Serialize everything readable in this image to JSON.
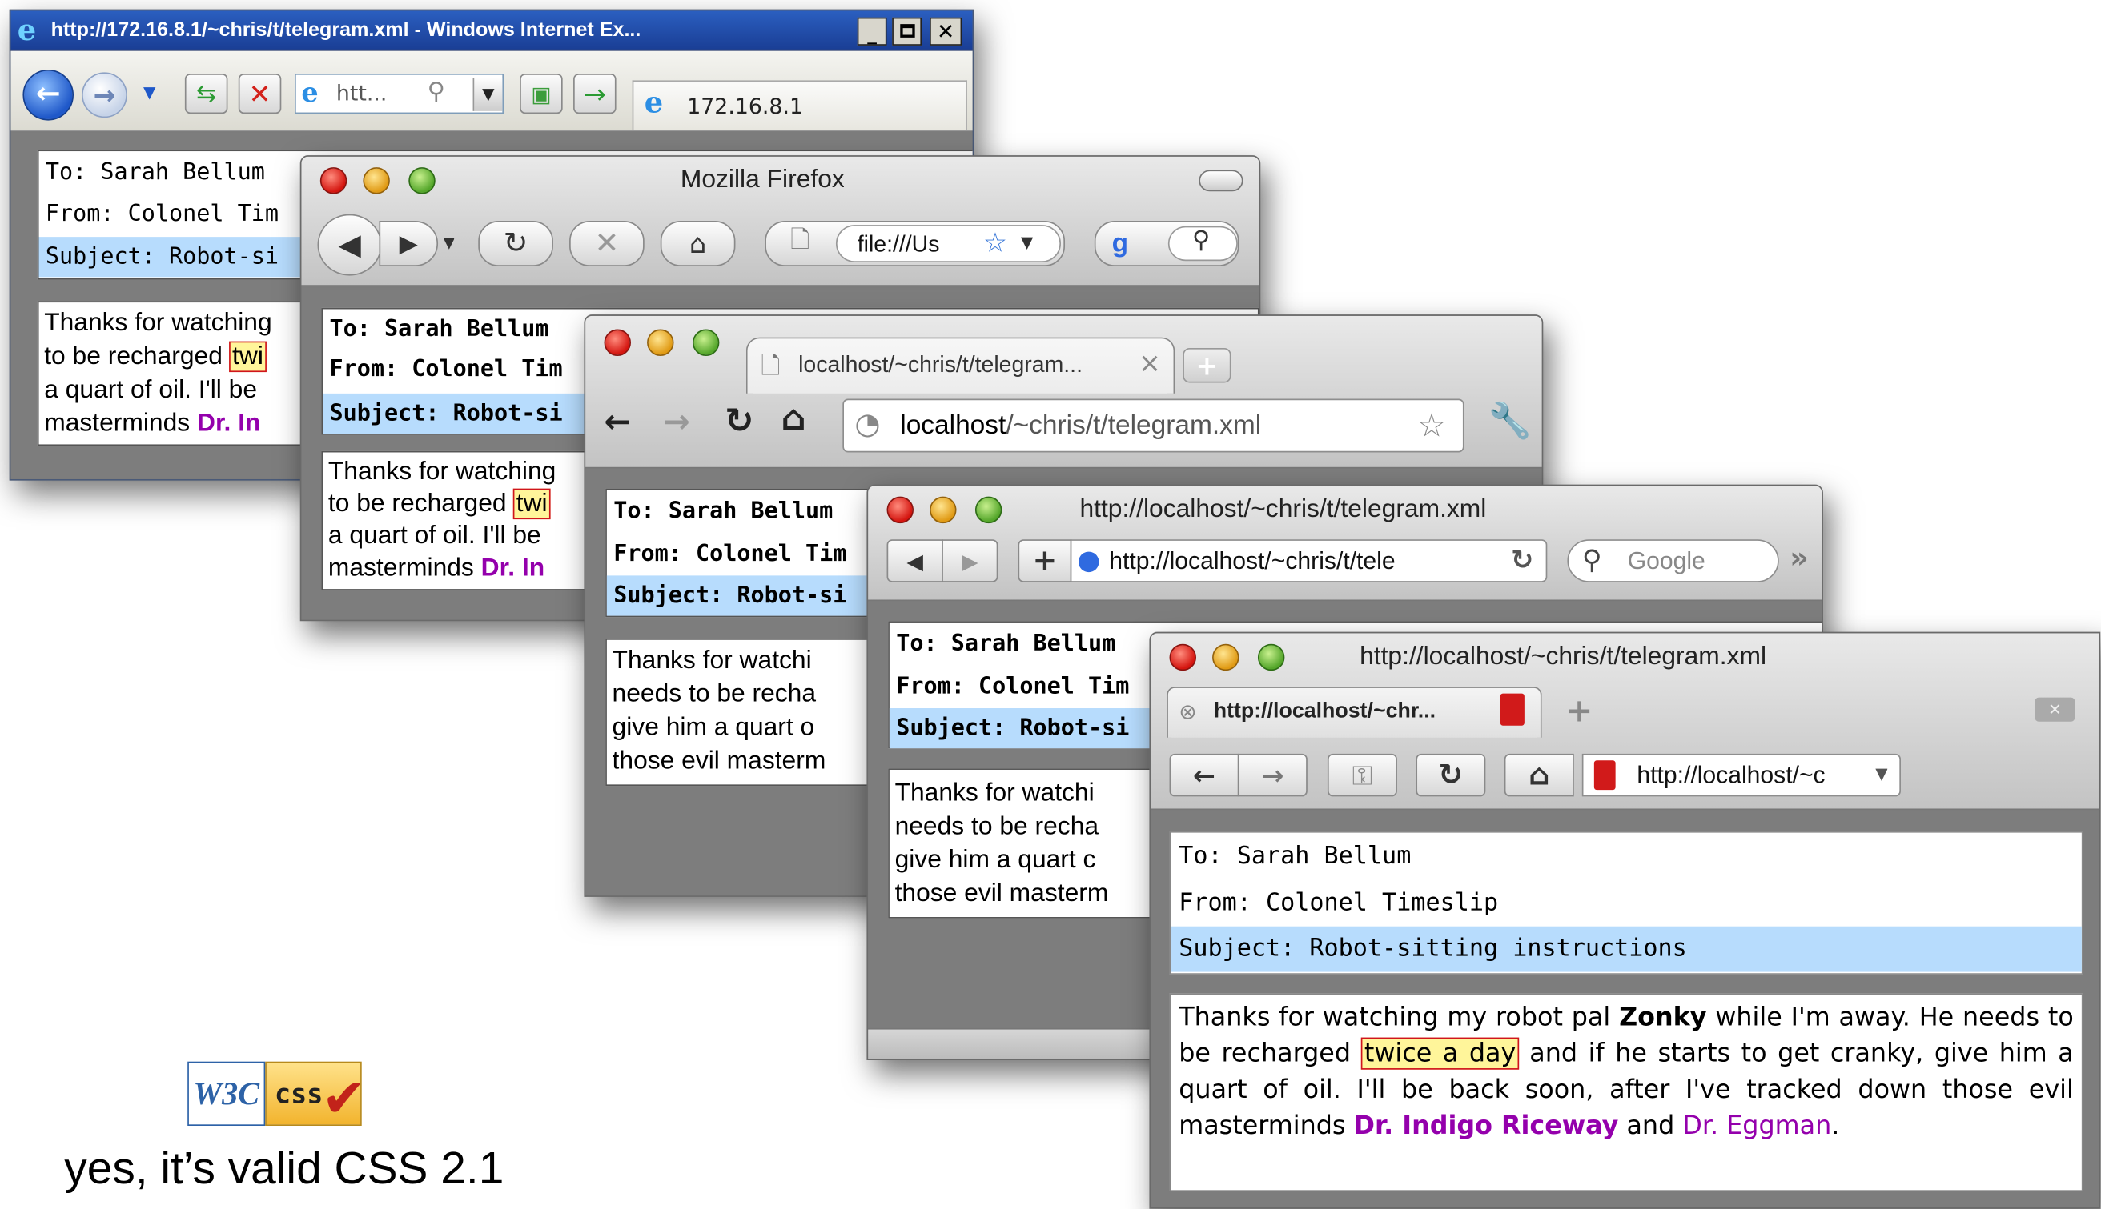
{
  "telegram": {
    "to": "To: Sarah Bellum",
    "from": "From: Colonel Timeslip",
    "subject": "Subject: Robot-sitting instructions",
    "body_p1": "Thanks for watching my robot pal ",
    "robot_name": "Zonky",
    "body_p2": " while I'm away. He needs to be recharged ",
    "highlight": "twice a day",
    "body_p3": " and if he starts to get cranky, give him a quart of oil. I'll be back soon, after I've tracked down those evil masterminds ",
    "villain1": "Dr. Indigo Riceway",
    "body_p4": " and ",
    "villain2": "Dr. Eggman",
    "body_p5": "."
  },
  "ie": {
    "title": "http://172.16.8.1/~chris/t/telegram.xml - Windows Internet Ex...",
    "address": "htt...",
    "tab": "172.16.8.1",
    "to": "To: Sarah Bellum",
    "from": "From: Colonel Tim",
    "subject": "Subject: Robot-si",
    "l1": "Thanks for watching",
    "l2": "to be recharged ",
    "l2_mark": "twi",
    "l3": "a quart of oil. I'll be",
    "l4": "masterminds ",
    "l4_purple": "Dr. In"
  },
  "firefox": {
    "title": "Mozilla Firefox",
    "address": "file:///Us",
    "to": "To: Sarah Bellum",
    "from": "From: Colonel Tim",
    "subject": "Subject: Robot-si",
    "l1": "Thanks for watching",
    "l2": "to be recharged ",
    "l2_mark": "twi",
    "l3": "a quart of oil. I'll be",
    "l4": "masterminds ",
    "l4_purple": "Dr. In"
  },
  "chrome": {
    "tab": "localhost/~chris/t/telegram...",
    "tab_close": "×",
    "new_tab": "+",
    "url_host": "localhost",
    "url_path": "/~chris/t/telegram.xml",
    "to": "To: Sarah Bellum",
    "from": "From: Colonel Tim",
    "subject": "Subject: Robot-si",
    "l1": "Thanks for watchi",
    "l2": "needs to be recha",
    "l3": "give him a quart o",
    "l4": "those evil masterm"
  },
  "safari": {
    "title": "http://localhost/~chris/t/telegram.xml",
    "address": "http://localhost/~chris/t/tele",
    "search": "Google",
    "plus": "+",
    "to": "To: Sarah Bellum",
    "from": "From: Colonel Tim",
    "subject": "Subject: Robot-si",
    "l1": "Thanks for watchi",
    "l2": "needs to be recha",
    "l3": "give him a quart c",
    "l4": "those evil masterm"
  },
  "opera": {
    "title": "http://localhost/~chris/t/telegram.xml",
    "tab": "http://localhost/~chr...",
    "address": "http://localhost/~c",
    "to": "To: Sarah Bellum",
    "from": "From: Colonel Timeslip",
    "subject": "Subject: Robot-sitting instructions"
  },
  "badge": {
    "w3c": "W3C",
    "css": "css"
  },
  "caption": "yes, it’s valid CSS 2.1"
}
